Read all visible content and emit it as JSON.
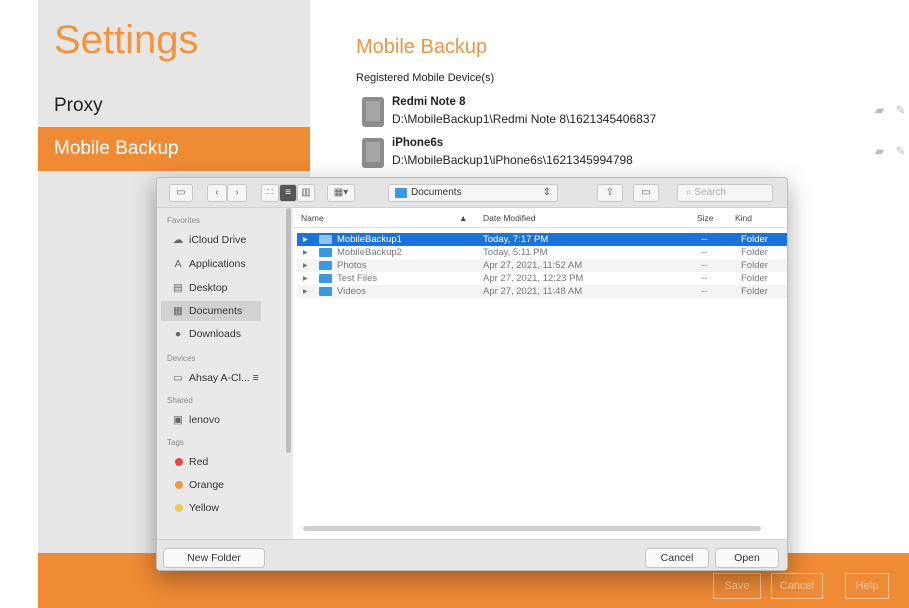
{
  "settings": {
    "title": "Settings",
    "items": [
      {
        "label": "Proxy"
      },
      {
        "label": "Mobile Backup"
      }
    ]
  },
  "main": {
    "title": "Mobile Backup",
    "section_label": "Registered Mobile Device(s)",
    "devices": [
      {
        "name": "Redmi Note 8",
        "path": "D:\\MobileBackup1\\Redmi Note 8\\1621345406837"
      },
      {
        "name": "iPhone6s",
        "path": "D:\\MobileBackup1\\iPhone6s\\1621345994798"
      }
    ]
  },
  "bottom": {
    "save": "Save",
    "cancel": "Cancel",
    "help": "Help"
  },
  "dialog": {
    "location": "Documents",
    "search_placeholder": "Search",
    "favorites_header": "Favorites",
    "favorites": [
      "iCloud Drive",
      "Applications",
      "Desktop",
      "Documents",
      "Downloads"
    ],
    "devices_header": "Devices",
    "device_item": "Ahsay A-Cl... ≡",
    "shared_header": "Shared",
    "shared_item": "lenovo",
    "tags_header": "Tags",
    "tags": [
      {
        "label": "Red",
        "color": "#e8474a"
      },
      {
        "label": "Orange",
        "color": "#f19a3a"
      },
      {
        "label": "Yellow",
        "color": "#f3c945"
      }
    ],
    "columns": {
      "name": "Name",
      "date": "Date Modified",
      "size": "Size",
      "kind": "Kind"
    },
    "files": [
      {
        "name": "MobileBackup1",
        "date": "Today, 7:17 PM",
        "size": "--",
        "kind": "Folder"
      },
      {
        "name": "MobileBackup2",
        "date": "Today, 5:11 PM",
        "size": "--",
        "kind": "Folder"
      },
      {
        "name": "Photos",
        "date": "Apr 27, 2021, 11:52 AM",
        "size": "--",
        "kind": "Folder"
      },
      {
        "name": "Test Files",
        "date": "Apr 27, 2021, 12:23 PM",
        "size": "--",
        "kind": "Folder"
      },
      {
        "name": "Videos",
        "date": "Apr 27, 2021, 11:48 AM",
        "size": "--",
        "kind": "Folder"
      }
    ],
    "new_folder": "New Folder",
    "cancel": "Cancel",
    "open": "Open"
  }
}
